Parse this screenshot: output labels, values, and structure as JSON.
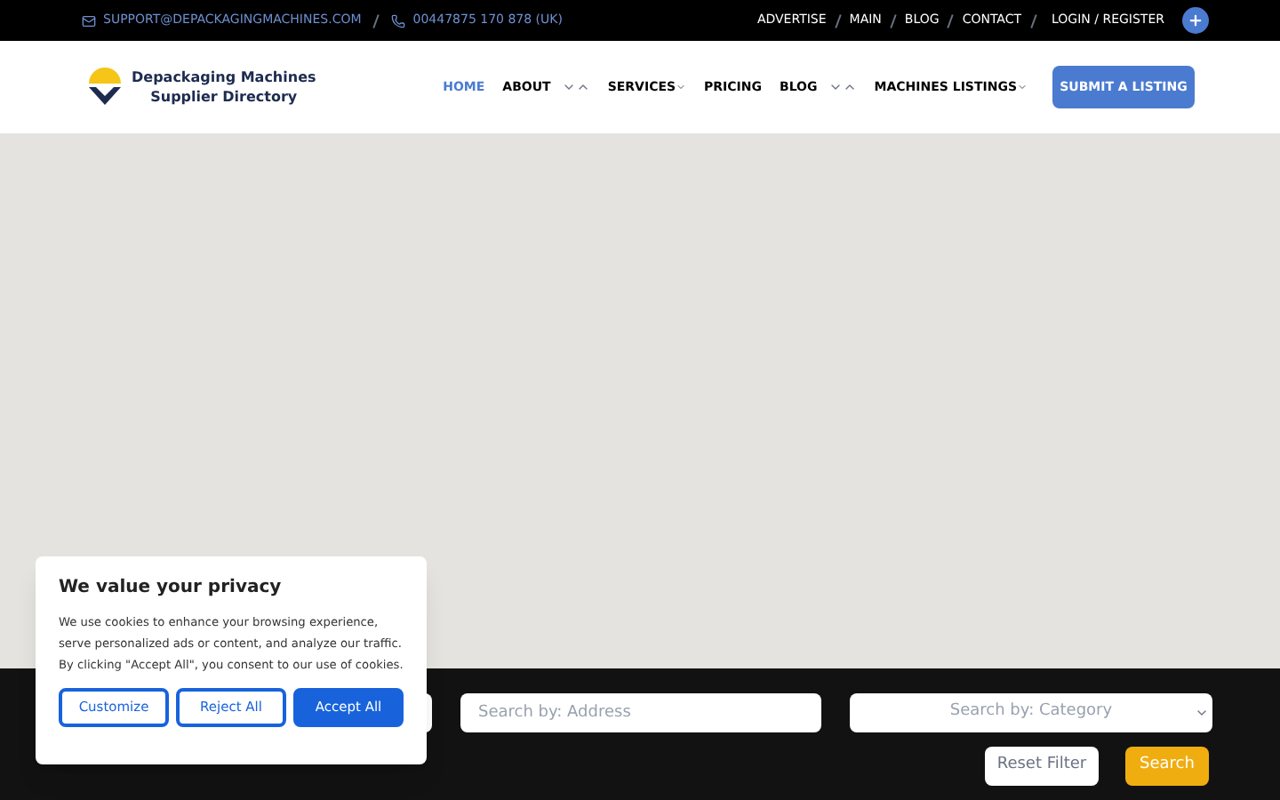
{
  "top_bar": {
    "email": "SUPPORT@DEPACKAGINGMACHINES.COM",
    "phone": "00447875 170 878 (UK)",
    "links": [
      "ADVERTISE",
      "MAIN",
      "BLOG",
      "CONTACT"
    ],
    "login": "LOGIN / REGISTER"
  },
  "header": {
    "logo_lines": [
      "Depackaging Machines",
      "Supplier Directory"
    ],
    "nav": [
      {
        "label": "HOME",
        "selected": true,
        "kind": "plain"
      },
      {
        "label": "ABOUT",
        "selected": false,
        "kind": "toggle"
      },
      {
        "label": "SERVICES",
        "selected": false,
        "kind": "caret"
      },
      {
        "label": "PRICING",
        "selected": false,
        "kind": "plain"
      },
      {
        "label": "BLOG",
        "selected": false,
        "kind": "toggle"
      },
      {
        "label": "MACHINES LISTINGS",
        "selected": false,
        "kind": "caret"
      }
    ],
    "cta": "SUBMIT A LISTING"
  },
  "search": {
    "address_placeholder": "Search by: Address",
    "category_placeholder": "Search by: Category",
    "reset": "Reset Filter",
    "submit": "Search"
  },
  "cookie_banner": {
    "title": "We value your privacy",
    "text": "We use cookies to enhance your browsing experience, serve personalized ads or content, and analyze our traffic. By clicking \"Accept All\", you consent to our use of cookies.",
    "buttons": [
      "Customize",
      "Reject All",
      "Accept All"
    ]
  }
}
